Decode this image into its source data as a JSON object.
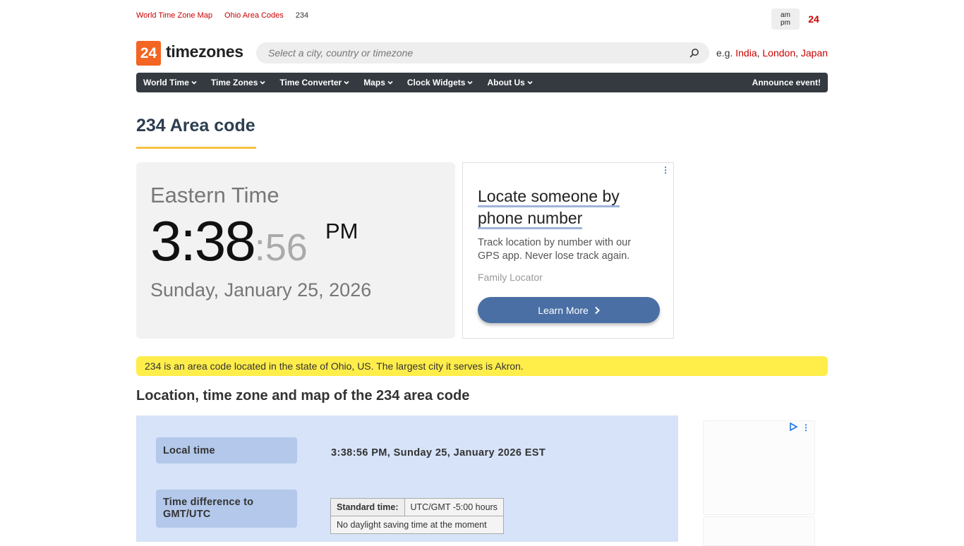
{
  "breadcrumb": {
    "items": [
      "World Time Zone Map",
      "Ohio Area Codes"
    ],
    "current": "234"
  },
  "format_toggle": {
    "ampm_top": "am",
    "ampm_bottom": "pm",
    "h24": "24"
  },
  "logo": {
    "number": "24",
    "text": "timezones"
  },
  "search": {
    "placeholder": "Select a city, country or timezone",
    "eg_label": "e.g.",
    "examples": [
      "India",
      "London",
      "Japan"
    ]
  },
  "nav": {
    "items": [
      "World Time",
      "Time Zones",
      "Time Converter",
      "Maps",
      "Clock Widgets",
      "About Us"
    ],
    "announce": "Announce event!"
  },
  "page": {
    "title": "234 Area code"
  },
  "clock": {
    "tz_name": "Eastern Time",
    "hm": "3:38",
    "sec": ":56",
    "ampm": "PM",
    "date": "Sunday, January 25, 2026"
  },
  "ad": {
    "title": "Locate someone by phone number",
    "text": "Track location by number with our GPS app. Never lose track again.",
    "brand": "Family Locator",
    "button": "Learn More"
  },
  "info_bar": "234 is an area code located in the state of Ohio, US. The largest city it serves is Akron.",
  "section": {
    "title": "Location, time zone and map of the 234 area code",
    "local_time_label": "Local time",
    "local_time_value": "3:38:56 PM, Sunday 25, January 2026 EST",
    "diff_label": "Time difference to GMT/UTC",
    "std_label": "Standard time:",
    "std_value": "UTC/GMT -5:00 hours",
    "dst_note": "No daylight saving time at the moment"
  },
  "colors": {
    "accent_red": "#c00000",
    "logo_orange": "#f26522",
    "nav_bg": "#343a40",
    "info_yellow": "#ffed4a",
    "panel_blue": "#d6e3f8"
  }
}
